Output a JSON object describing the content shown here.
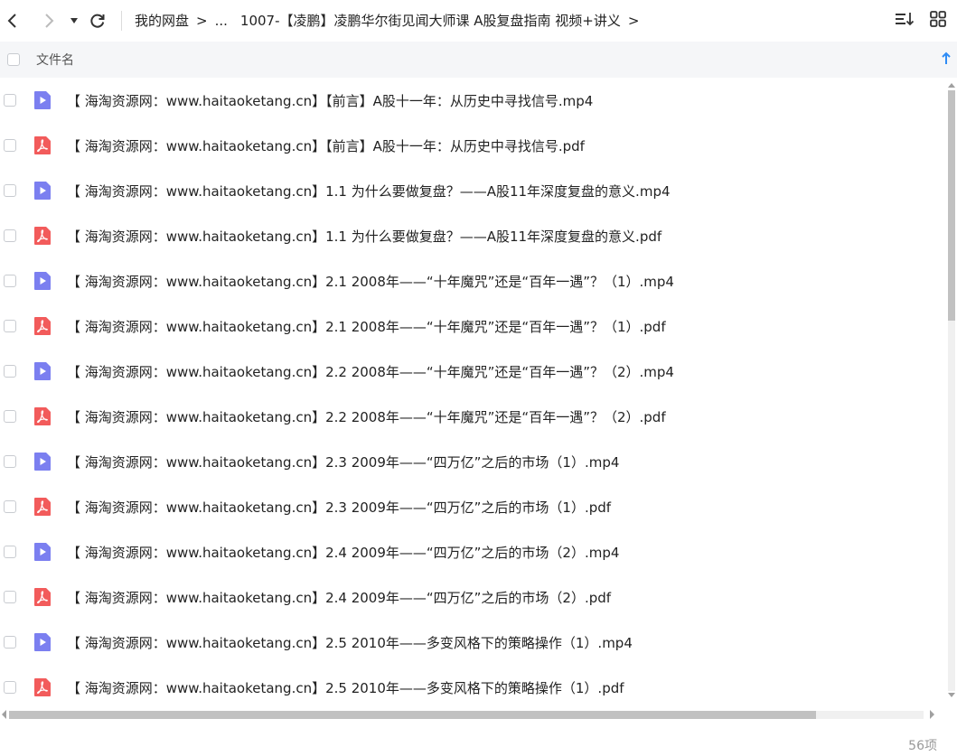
{
  "breadcrumb": {
    "root": "我的网盘",
    "ellipsis": "...",
    "current": "1007-【凌鹏】凌鹏华尔街见闻大师课 A股复盘指南 视频+讲义"
  },
  "header": {
    "column_label": "文件名"
  },
  "files": [
    {
      "name": "【 海淘资源网：www.haitaoketang.cn】【前言】A股十一年：从历史中寻找信号.mp4",
      "type": "video"
    },
    {
      "name": "【 海淘资源网：www.haitaoketang.cn】【前言】A股十一年：从历史中寻找信号.pdf",
      "type": "pdf"
    },
    {
      "name": "【 海淘资源网：www.haitaoketang.cn】1.1 为什么要做复盘？——A股11年深度复盘的意义.mp4",
      "type": "video"
    },
    {
      "name": "【 海淘资源网：www.haitaoketang.cn】1.1 为什么要做复盘？——A股11年深度复盘的意义.pdf",
      "type": "pdf"
    },
    {
      "name": "【 海淘资源网：www.haitaoketang.cn】2.1 2008年——“十年魔咒”还是“百年一遇”？（1）.mp4",
      "type": "video"
    },
    {
      "name": "【 海淘资源网：www.haitaoketang.cn】2.1 2008年——“十年魔咒”还是“百年一遇”？（1）.pdf",
      "type": "pdf"
    },
    {
      "name": "【 海淘资源网：www.haitaoketang.cn】2.2 2008年——“十年魔咒”还是“百年一遇”？（2）.mp4",
      "type": "video"
    },
    {
      "name": "【 海淘资源网：www.haitaoketang.cn】2.2 2008年——“十年魔咒”还是“百年一遇”？（2）.pdf",
      "type": "pdf"
    },
    {
      "name": "【 海淘资源网：www.haitaoketang.cn】2.3 2009年——“四万亿”之后的市场（1）.mp4",
      "type": "video"
    },
    {
      "name": "【 海淘资源网：www.haitaoketang.cn】2.3 2009年——“四万亿”之后的市场（1）.pdf",
      "type": "pdf"
    },
    {
      "name": "【 海淘资源网：www.haitaoketang.cn】2.4 2009年——“四万亿”之后的市场（2）.mp4",
      "type": "video"
    },
    {
      "name": "【 海淘资源网：www.haitaoketang.cn】2.4 2009年——“四万亿”之后的市场（2）.pdf",
      "type": "pdf"
    },
    {
      "name": "【 海淘资源网：www.haitaoketang.cn】2.5 2010年——多变风格下的策略操作（1）.mp4",
      "type": "video"
    },
    {
      "name": "【 海淘资源网：www.haitaoketang.cn】2.5 2010年——多变风格下的策略操作（1）.pdf",
      "type": "pdf"
    }
  ],
  "footer": {
    "item_count": "56项"
  },
  "colors": {
    "video_icon": "#7b7ff0",
    "pdf_icon": "#f25b5b",
    "sort_arrow": "#2f8cf5"
  }
}
